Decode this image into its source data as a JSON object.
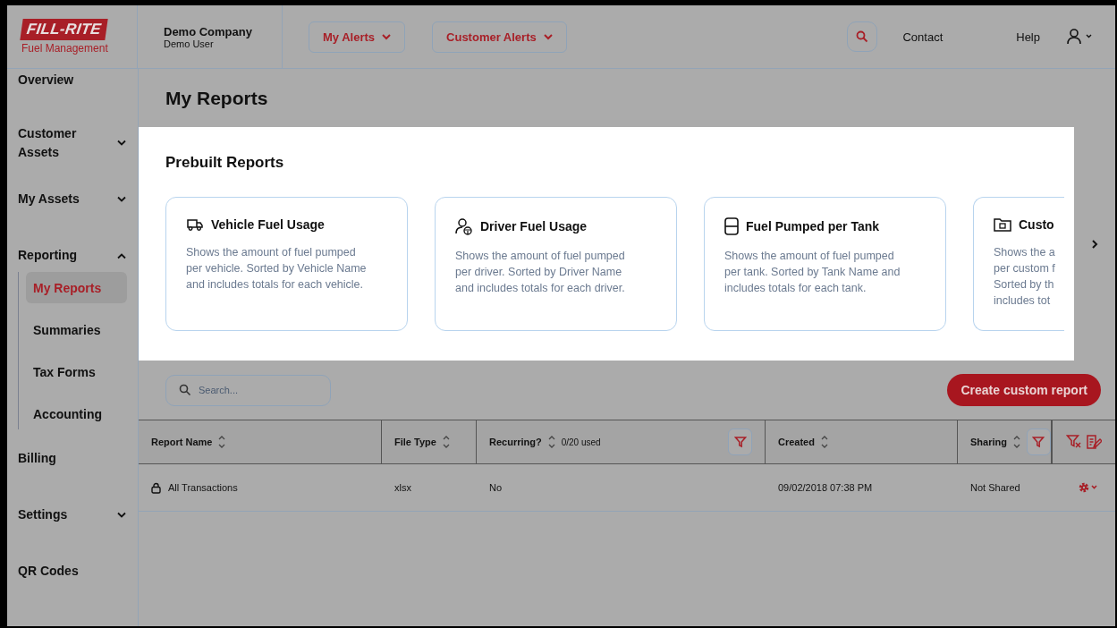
{
  "header": {
    "logo": {
      "brand": "FILL-RITE",
      "subtitle": "Fuel Management"
    },
    "account": {
      "company": "Demo Company",
      "user": "Demo User"
    },
    "alert_buttons": [
      {
        "label": "My Alerts"
      },
      {
        "label": "Customer Alerts"
      }
    ],
    "links": [
      {
        "label": "Contact"
      },
      {
        "label": "Help"
      }
    ]
  },
  "sidebar": {
    "items": [
      {
        "label": "Overview",
        "kind": "link"
      },
      {
        "label": "Customer Assets",
        "kind": "group",
        "expanded": false
      },
      {
        "label": "My Assets",
        "kind": "group",
        "expanded": false
      },
      {
        "label": "Reporting",
        "kind": "group",
        "expanded": true,
        "children": [
          {
            "label": "My Reports",
            "selected": true
          },
          {
            "label": "Summaries",
            "selected": false
          },
          {
            "label": "Tax Forms",
            "selected": false
          },
          {
            "label": "Accounting",
            "selected": false
          }
        ]
      },
      {
        "label": "Billing",
        "kind": "link"
      },
      {
        "label": "Settings",
        "kind": "group",
        "expanded": false
      },
      {
        "label": "QR Codes",
        "kind": "link"
      }
    ]
  },
  "page_title": "My Reports",
  "prebuilt": {
    "title": "Prebuilt Reports",
    "cards": [
      {
        "title": "Vehicle Fuel Usage",
        "lines": [
          "Shows the amount of fuel pumped",
          "per vehicle. Sorted by Vehicle Name",
          "and includes totals for each vehicle."
        ]
      },
      {
        "title": "Driver Fuel Usage",
        "lines": [
          "Shows the amount of fuel pumped",
          "per driver. Sorted by Driver Name",
          "and includes totals for each driver."
        ]
      },
      {
        "title": "Fuel Pumped per Tank",
        "lines": [
          "Shows the amount of fuel pumped",
          "per tank. Sorted by Tank Name and",
          "includes totals for each tank."
        ]
      },
      {
        "title": "Custo",
        "lines": [
          "Shows the a",
          "per custom f",
          "Sorted by th",
          "includes tot"
        ]
      }
    ]
  },
  "search": {
    "placeholder": "Search..."
  },
  "create_button": "Create custom report",
  "table": {
    "columns": [
      {
        "label": "Report Name",
        "sortable": true,
        "filter_button": false
      },
      {
        "label": "File Type",
        "sortable": true,
        "filter_button": false
      },
      {
        "label": "Recurring?",
        "sortable": true,
        "note": "0/20 used",
        "filter_button": true
      },
      {
        "label": "Created",
        "sortable": true,
        "filter_button": false
      },
      {
        "label": "Sharing",
        "sortable": true,
        "filter_button": true
      }
    ],
    "rows": [
      {
        "locked": true,
        "cells": [
          "All Transactions",
          "xlsx",
          "No",
          "09/02/2018 07:38 PM",
          "Not Shared"
        ]
      }
    ]
  }
}
